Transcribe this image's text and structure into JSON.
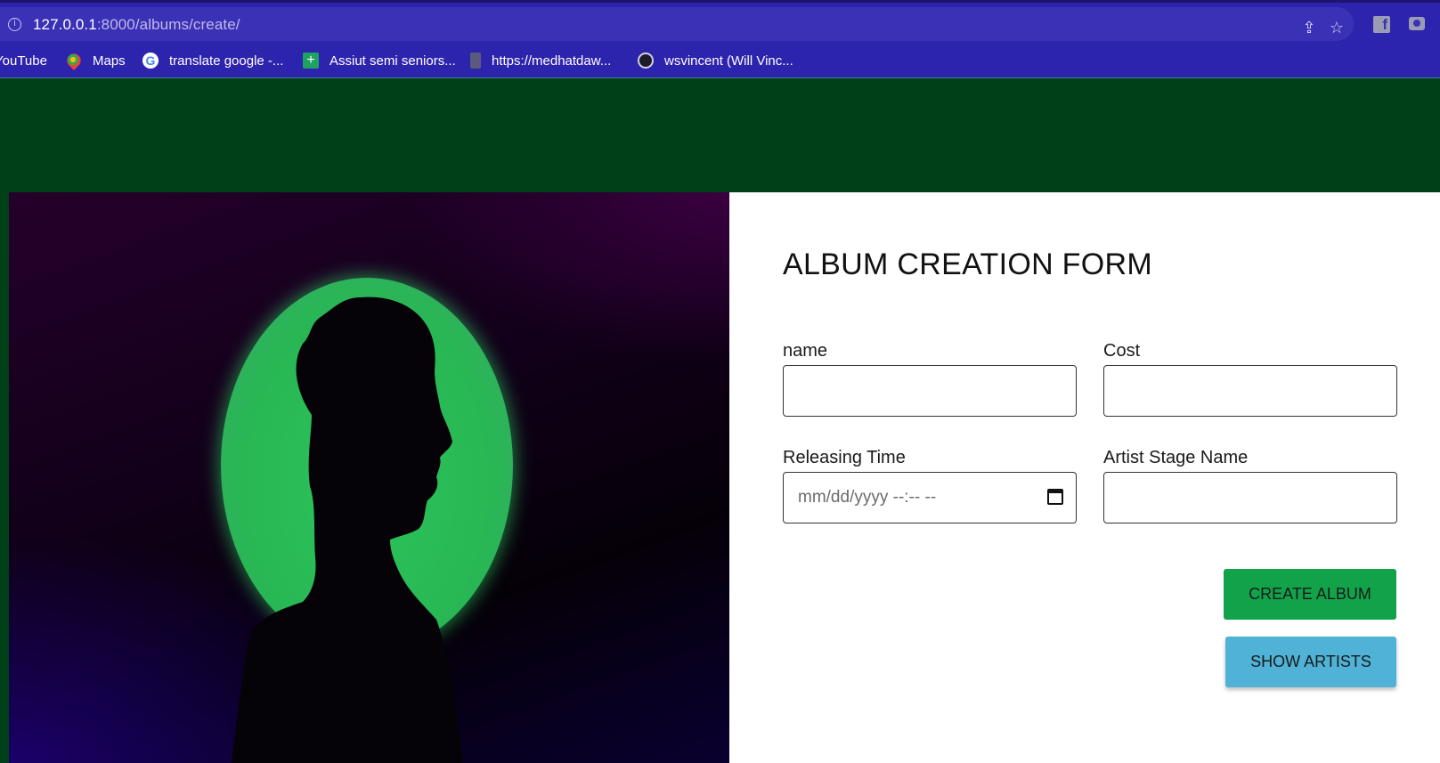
{
  "browser": {
    "url_host": "127.0.0.1",
    "url_path": ":8000/albums/create/",
    "bookmarks": [
      {
        "label": "YouTube",
        "icon": "youtube-icon"
      },
      {
        "label": "Maps",
        "icon": "maps-icon"
      },
      {
        "label": "translate google -...",
        "icon": "google-icon"
      },
      {
        "label": "Assiut semi seniors...",
        "icon": "sheets-icon"
      },
      {
        "label": "https://medhatdaw...",
        "icon": "site-icon"
      },
      {
        "label": "wsvincent (Will Vinc...",
        "icon": "github-icon"
      }
    ]
  },
  "form": {
    "title": "ALBUM CREATION FORM",
    "fields": {
      "name": {
        "label": "name",
        "value": ""
      },
      "cost": {
        "label": "Cost",
        "value": ""
      },
      "releasing_time": {
        "label": "Releasing Time",
        "placeholder": "mm/dd/yyyy --:-- --"
      },
      "artist_stage_name": {
        "label": "Artist Stage Name",
        "value": ""
      }
    },
    "create_button": "CREATE ALBUM",
    "show_artists_button": "SHOW ARTISTS"
  },
  "colors": {
    "page_background": "#004019",
    "browser_bar": "#2d24ad",
    "create_button": "#12a34a",
    "show_artists_button": "#4fb2d6",
    "glow": "#2cc45a"
  }
}
